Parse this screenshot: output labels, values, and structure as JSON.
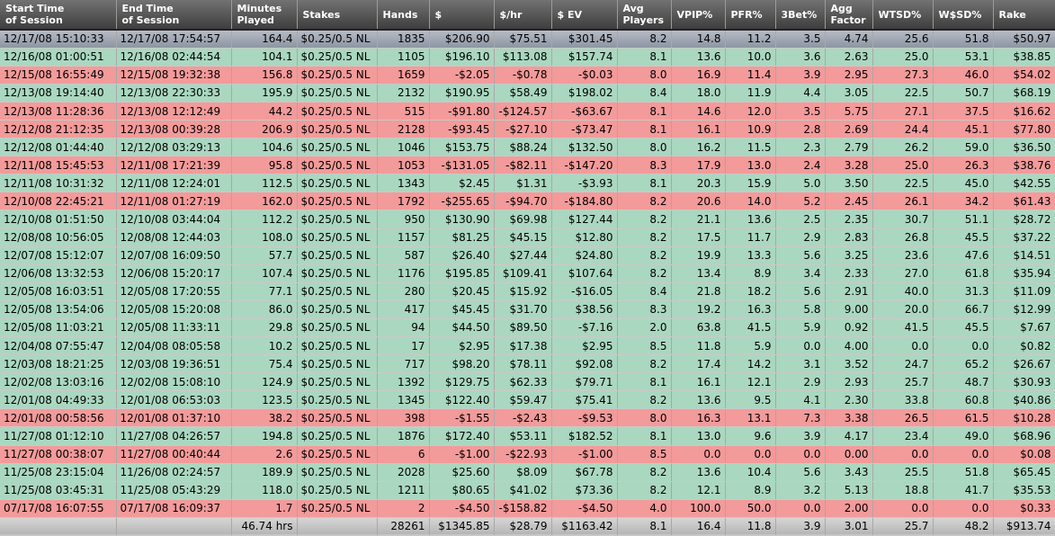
{
  "columns": [
    {
      "label": "Start Time\nof Session",
      "align": "txt",
      "name": "start-time"
    },
    {
      "label": "End Time\nof Session",
      "align": "txt",
      "name": "end-time"
    },
    {
      "label": "Minutes\nPlayed",
      "align": "num",
      "name": "minutes-played"
    },
    {
      "label": "Stakes",
      "align": "txt",
      "name": "stakes"
    },
    {
      "label": "Hands",
      "align": "num",
      "name": "hands"
    },
    {
      "label": "$",
      "align": "num",
      "name": "dollars"
    },
    {
      "label": "$/hr",
      "align": "num",
      "name": "dollars-per-hour"
    },
    {
      "label": "$ EV",
      "align": "num",
      "name": "dollars-ev"
    },
    {
      "label": "Avg\nPlayers",
      "align": "num",
      "name": "avg-players"
    },
    {
      "label": "VPIP%",
      "align": "num",
      "name": "vpip"
    },
    {
      "label": "PFR%",
      "align": "num",
      "name": "pfr"
    },
    {
      "label": "3Bet%",
      "align": "num",
      "name": "three-bet"
    },
    {
      "label": "Agg\nFactor",
      "align": "num",
      "name": "agg-factor"
    },
    {
      "label": "WTSD%",
      "align": "num",
      "name": "wtsd"
    },
    {
      "label": "W$SD%",
      "align": "num",
      "name": "wsd"
    },
    {
      "label": "Rake",
      "align": "num",
      "name": "rake"
    }
  ],
  "colors": {
    "win_row": "#aad7c0",
    "loss_row": "#f39a9a",
    "selected_row": "#a3aab5",
    "header": "#4a4a4a",
    "total_money": "#1a7f1a"
  },
  "rows": [
    {
      "state": "selected",
      "cells": [
        "12/17/08 15:10:33",
        "12/17/08 17:54:57",
        "164.4",
        "$0.25/0.5 NL",
        "1835",
        "$206.90",
        "$75.51",
        "$301.45",
        "8.2",
        "14.8",
        "11.2",
        "3.5",
        "4.74",
        "25.6",
        "51.8",
        "$50.97"
      ]
    },
    {
      "state": "win",
      "cells": [
        "12/16/08 01:00:51",
        "12/16/08 02:44:54",
        "104.1",
        "$0.25/0.5 NL",
        "1105",
        "$196.10",
        "$113.08",
        "$157.74",
        "8.1",
        "13.6",
        "10.0",
        "3.6",
        "2.63",
        "25.0",
        "53.1",
        "$38.85"
      ]
    },
    {
      "state": "loss",
      "cells": [
        "12/15/08 16:55:49",
        "12/15/08 19:32:38",
        "156.8",
        "$0.25/0.5 NL",
        "1659",
        "-$2.05",
        "-$0.78",
        "-$0.03",
        "8.0",
        "16.9",
        "11.4",
        "3.9",
        "2.95",
        "27.3",
        "46.0",
        "$54.02"
      ]
    },
    {
      "state": "win",
      "cells": [
        "12/13/08 19:14:40",
        "12/13/08 22:30:33",
        "195.9",
        "$0.25/0.5 NL",
        "2132",
        "$190.95",
        "$58.49",
        "$198.02",
        "8.4",
        "18.0",
        "11.9",
        "4.4",
        "3.05",
        "22.5",
        "50.7",
        "$68.19"
      ]
    },
    {
      "state": "loss",
      "cells": [
        "12/13/08 11:28:36",
        "12/13/08 12:12:49",
        "44.2",
        "$0.25/0.5 NL",
        "515",
        "-$91.80",
        "-$124.57",
        "-$63.67",
        "8.1",
        "14.6",
        "12.0",
        "3.5",
        "5.75",
        "27.1",
        "37.5",
        "$16.62"
      ]
    },
    {
      "state": "loss",
      "cells": [
        "12/12/08 21:12:35",
        "12/13/08 00:39:28",
        "206.9",
        "$0.25/0.5 NL",
        "2128",
        "-$93.45",
        "-$27.10",
        "-$73.47",
        "8.1",
        "16.1",
        "10.9",
        "2.8",
        "2.69",
        "24.4",
        "45.1",
        "$77.80"
      ]
    },
    {
      "state": "win",
      "cells": [
        "12/12/08 01:44:40",
        "12/12/08 03:29:13",
        "104.6",
        "$0.25/0.5 NL",
        "1046",
        "$153.75",
        "$88.24",
        "$132.50",
        "8.0",
        "16.2",
        "11.5",
        "2.3",
        "2.79",
        "26.2",
        "59.0",
        "$36.50"
      ]
    },
    {
      "state": "loss",
      "cells": [
        "12/11/08 15:45:53",
        "12/11/08 17:21:39",
        "95.8",
        "$0.25/0.5 NL",
        "1053",
        "-$131.05",
        "-$82.11",
        "-$147.20",
        "8.3",
        "17.9",
        "13.0",
        "2.4",
        "3.28",
        "25.0",
        "26.3",
        "$38.76"
      ]
    },
    {
      "state": "win",
      "cells": [
        "12/11/08 10:31:32",
        "12/11/08 12:24:01",
        "112.5",
        "$0.25/0.5 NL",
        "1343",
        "$2.45",
        "$1.31",
        "-$3.93",
        "8.1",
        "20.3",
        "15.9",
        "5.0",
        "3.50",
        "22.5",
        "45.0",
        "$42.55"
      ]
    },
    {
      "state": "loss",
      "cells": [
        "12/10/08 22:45:21",
        "12/11/08 01:27:19",
        "162.0",
        "$0.25/0.5 NL",
        "1792",
        "-$255.65",
        "-$94.70",
        "-$184.80",
        "8.2",
        "20.6",
        "14.0",
        "5.2",
        "2.45",
        "26.1",
        "34.2",
        "$61.43"
      ]
    },
    {
      "state": "win",
      "cells": [
        "12/10/08 01:51:50",
        "12/10/08 03:44:04",
        "112.2",
        "$0.25/0.5 NL",
        "950",
        "$130.90",
        "$69.98",
        "$127.44",
        "8.2",
        "21.1",
        "13.6",
        "2.5",
        "2.35",
        "30.7",
        "51.1",
        "$28.72"
      ]
    },
    {
      "state": "win",
      "cells": [
        "12/08/08 10:56:05",
        "12/08/08 12:44:03",
        "108.0",
        "$0.25/0.5 NL",
        "1157",
        "$81.25",
        "$45.15",
        "$12.80",
        "8.2",
        "17.5",
        "11.7",
        "2.9",
        "2.83",
        "26.8",
        "45.5",
        "$37.22"
      ]
    },
    {
      "state": "win",
      "cells": [
        "12/07/08 15:12:07",
        "12/07/08 16:09:50",
        "57.7",
        "$0.25/0.5 NL",
        "587",
        "$26.40",
        "$27.44",
        "$24.80",
        "8.2",
        "19.9",
        "13.3",
        "5.6",
        "3.25",
        "23.6",
        "47.6",
        "$14.51"
      ]
    },
    {
      "state": "win",
      "cells": [
        "12/06/08 13:32:53",
        "12/06/08 15:20:17",
        "107.4",
        "$0.25/0.5 NL",
        "1176",
        "$195.85",
        "$109.41",
        "$107.64",
        "8.2",
        "13.4",
        "8.9",
        "3.4",
        "2.33",
        "27.0",
        "61.8",
        "$35.94"
      ]
    },
    {
      "state": "win",
      "cells": [
        "12/05/08 16:03:51",
        "12/05/08 17:20:55",
        "77.1",
        "$0.25/0.5 NL",
        "280",
        "$20.45",
        "$15.92",
        "-$16.05",
        "8.4",
        "21.8",
        "18.2",
        "5.6",
        "2.91",
        "40.0",
        "31.3",
        "$11.09"
      ]
    },
    {
      "state": "win",
      "cells": [
        "12/05/08 13:54:06",
        "12/05/08 15:20:08",
        "86.0",
        "$0.25/0.5 NL",
        "417",
        "$45.45",
        "$31.70",
        "$38.56",
        "8.3",
        "19.2",
        "16.3",
        "5.8",
        "9.00",
        "20.0",
        "66.7",
        "$12.99"
      ]
    },
    {
      "state": "win",
      "cells": [
        "12/05/08 11:03:21",
        "12/05/08 11:33:11",
        "29.8",
        "$0.25/0.5 NL",
        "94",
        "$44.50",
        "$89.50",
        "-$7.16",
        "2.0",
        "63.8",
        "41.5",
        "5.9",
        "0.92",
        "41.5",
        "45.5",
        "$7.67"
      ]
    },
    {
      "state": "win",
      "cells": [
        "12/04/08 07:55:47",
        "12/04/08 08:05:58",
        "10.2",
        "$0.25/0.5 NL",
        "17",
        "$2.95",
        "$17.38",
        "$2.95",
        "8.5",
        "11.8",
        "5.9",
        "0.0",
        "4.00",
        "0.0",
        "0.0",
        "$0.82"
      ]
    },
    {
      "state": "win",
      "cells": [
        "12/03/08 18:21:25",
        "12/03/08 19:36:51",
        "75.4",
        "$0.25/0.5 NL",
        "717",
        "$98.20",
        "$78.11",
        "$92.08",
        "8.2",
        "17.4",
        "14.2",
        "3.1",
        "3.52",
        "24.7",
        "65.2",
        "$26.67"
      ]
    },
    {
      "state": "win",
      "cells": [
        "12/02/08 13:03:16",
        "12/02/08 15:08:10",
        "124.9",
        "$0.25/0.5 NL",
        "1392",
        "$129.75",
        "$62.33",
        "$79.71",
        "8.1",
        "16.1",
        "12.1",
        "2.9",
        "2.93",
        "25.7",
        "48.7",
        "$30.93"
      ]
    },
    {
      "state": "win",
      "cells": [
        "12/01/08 04:49:33",
        "12/01/08 06:53:03",
        "123.5",
        "$0.25/0.5 NL",
        "1345",
        "$122.40",
        "$59.47",
        "$75.41",
        "8.2",
        "13.6",
        "9.5",
        "4.1",
        "2.30",
        "33.8",
        "60.8",
        "$40.86"
      ]
    },
    {
      "state": "loss",
      "cells": [
        "12/01/08 00:58:56",
        "12/01/08 01:37:10",
        "38.2",
        "$0.25/0.5 NL",
        "398",
        "-$1.55",
        "-$2.43",
        "-$9.53",
        "8.0",
        "16.3",
        "13.1",
        "7.3",
        "3.38",
        "26.5",
        "61.5",
        "$10.28"
      ]
    },
    {
      "state": "win",
      "cells": [
        "11/27/08 01:12:10",
        "11/27/08 04:26:57",
        "194.8",
        "$0.25/0.5 NL",
        "1876",
        "$172.40",
        "$53.11",
        "$182.52",
        "8.1",
        "13.0",
        "9.6",
        "3.9",
        "4.17",
        "23.4",
        "49.0",
        "$68.96"
      ]
    },
    {
      "state": "loss",
      "cells": [
        "11/27/08 00:38:07",
        "11/27/08 00:40:44",
        "2.6",
        "$0.25/0.5 NL",
        "6",
        "-$1.00",
        "-$22.93",
        "-$1.00",
        "8.5",
        "0.0",
        "0.0",
        "0.0",
        "0.00",
        "0.0",
        "0.0",
        "$0.08"
      ]
    },
    {
      "state": "win",
      "cells": [
        "11/25/08 23:15:04",
        "11/26/08 02:24:57",
        "189.9",
        "$0.25/0.5 NL",
        "2028",
        "$25.60",
        "$8.09",
        "$67.78",
        "8.2",
        "13.6",
        "10.4",
        "5.6",
        "3.43",
        "25.5",
        "51.8",
        "$65.45"
      ]
    },
    {
      "state": "win",
      "cells": [
        "11/25/08 03:45:31",
        "11/25/08 05:43:29",
        "118.0",
        "$0.25/0.5 NL",
        "1211",
        "$80.65",
        "$41.02",
        "$73.36",
        "8.2",
        "12.1",
        "8.9",
        "3.2",
        "5.13",
        "18.8",
        "41.7",
        "$35.53"
      ]
    },
    {
      "state": "loss",
      "cells": [
        "07/17/08 16:07:55",
        "07/17/08 16:09:37",
        "1.7",
        "$0.25/0.5 NL",
        "2",
        "-$4.50",
        "-$158.82",
        "-$4.50",
        "4.0",
        "100.0",
        "50.0",
        "0.0",
        "2.00",
        "0.0",
        "0.0",
        "$0.33"
      ]
    }
  ],
  "totals": [
    "",
    "",
    "46.74 hrs",
    "",
    "28261",
    "$1345.85",
    "$28.79",
    "$1163.42",
    "8.1",
    "16.4",
    "11.8",
    "3.9",
    "3.01",
    "25.7",
    "48.2",
    "$913.74"
  ]
}
